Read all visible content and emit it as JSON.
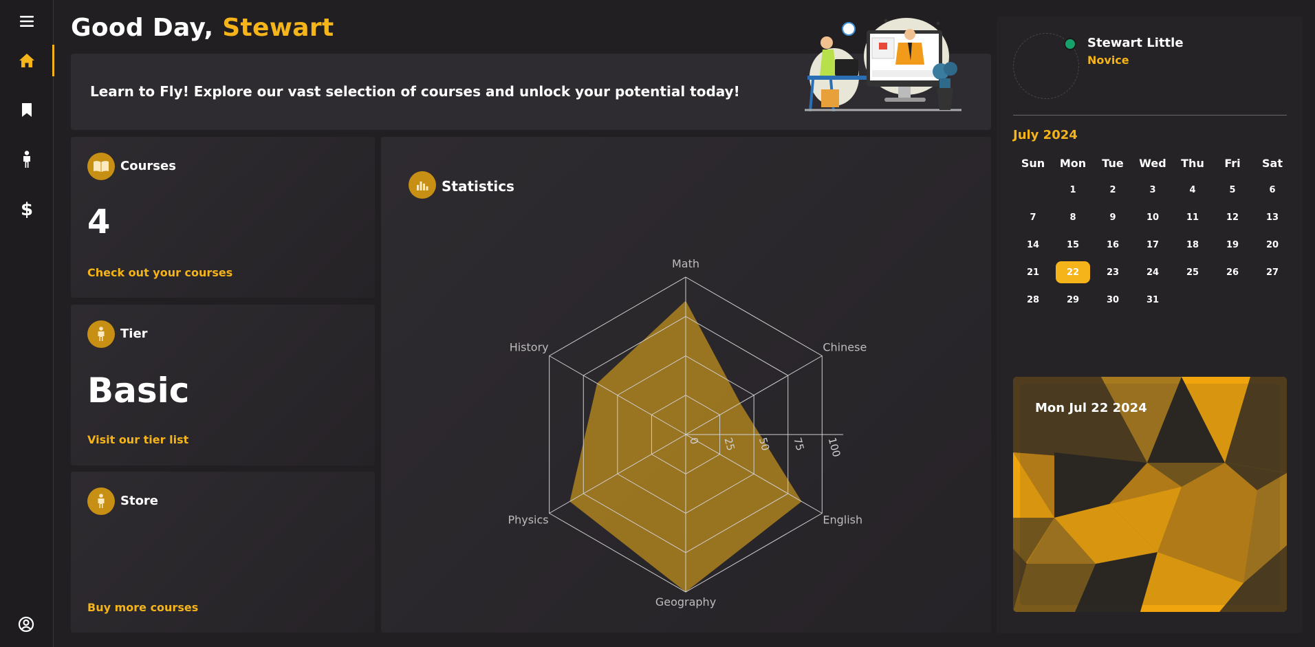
{
  "sidebar": {
    "items": [
      {
        "icon": "menu-icon"
      },
      {
        "icon": "home-icon",
        "active": true
      },
      {
        "icon": "bookmark-icon"
      },
      {
        "icon": "person-icon"
      },
      {
        "icon": "dollar-icon"
      }
    ],
    "bottom_icon": "user-circle-icon"
  },
  "header": {
    "greeting": "Good Day,",
    "user_first_name": "Stewart"
  },
  "banner": {
    "text": "Learn to Fly! Explore our vast selection of courses and unlock your potential today!"
  },
  "cards": {
    "courses": {
      "title": "Courses",
      "value": "4",
      "link": "Check out your courses"
    },
    "tier": {
      "title": "Tier",
      "value": "Basic",
      "link": "Visit our tier list"
    },
    "store": {
      "title": "Store",
      "link": "Buy more courses"
    }
  },
  "statistics": {
    "title": "Statistics"
  },
  "chart_data": {
    "type": "radar",
    "categories": [
      "Math",
      "Chinese",
      "English",
      "Geography",
      "Physics",
      "History"
    ],
    "series": [
      {
        "values": [
          85,
          40,
          85,
          100,
          85,
          65
        ]
      }
    ],
    "rlim": [
      0,
      100
    ],
    "ticks": [
      "0",
      "25",
      "50",
      "75",
      "100"
    ],
    "color": "#f4b41a"
  },
  "profile": {
    "name": "Stewart Little",
    "rank": "Novice",
    "status_color": "#16a06a"
  },
  "calendar": {
    "month_label": "July 2024",
    "weekdays": [
      "Sun",
      "Mon",
      "Tue",
      "Wed",
      "Thu",
      "Fri",
      "Sat"
    ],
    "first_weekday": 1,
    "days_in_month": 31,
    "selected_day": 22
  },
  "date_card": {
    "label": "Mon Jul 22 2024"
  },
  "colors": {
    "accent": "#f4b41a",
    "background": "#211f22",
    "card": "#2e2b30"
  }
}
